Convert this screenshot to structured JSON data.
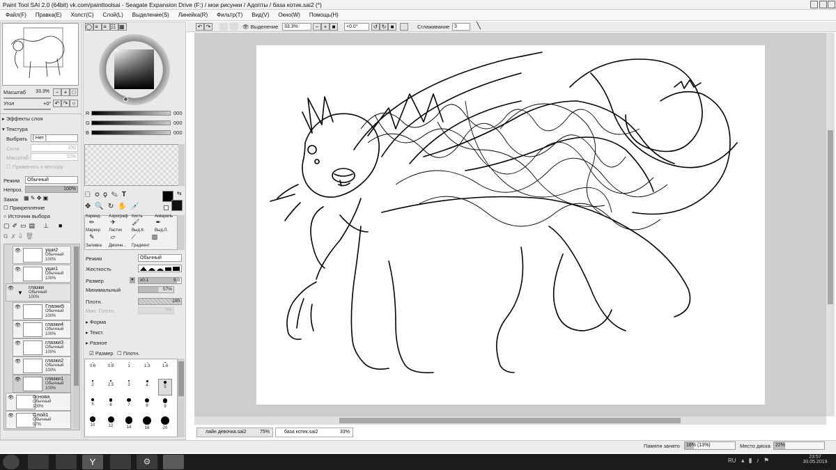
{
  "window": {
    "title": "Paint Tool SAI 2.0 (64bit) vk.com/painttoolsai - Seagate Expansion Drive (F:) / мои рисунки / Адопты / база котик.sai2 (*)"
  },
  "menu": [
    "Файл(F)",
    "Правка(E)",
    "Холст(C)",
    "Слой(L)",
    "Выделение(S)",
    "Линейка(R)",
    "Фильтр(T)",
    "Вид(V)",
    "Окно(W)",
    "Помощь(H)"
  ],
  "navigator": {
    "zoom_label": "Масштаб",
    "zoom_value": "33.3%",
    "angle_label": "Угол",
    "angle_value": "+0°"
  },
  "effects": {
    "header": "Эффекты слоя",
    "texture_header": "Текстура",
    "select_label": "Выбрать",
    "select_value": "[ Нет ]",
    "strength_label": "Сила",
    "strength_value": "100",
    "scale_label": "Масштаб",
    "scale_value": "10%",
    "apply_vector": "Применить к вектору"
  },
  "layer_props": {
    "mode_label": "Режим",
    "mode_value": "Обычный",
    "opacity_label": "Непроз.",
    "opacity_value": "100%",
    "lock_label": "Замок",
    "clip_label": "Прикрепление",
    "source_label": "Источник выбора"
  },
  "layers": [
    {
      "name": "уши2",
      "mode": "Обычный",
      "opacity": "100%"
    },
    {
      "name": "уши1",
      "mode": "Обычный",
      "opacity": "100%"
    },
    {
      "name": "глазки",
      "mode": "Обычный",
      "opacity": "100%",
      "folder": true
    },
    {
      "name": "Глазки5",
      "mode": "Обычный",
      "opacity": "100%"
    },
    {
      "name": "глазки4",
      "mode": "Обычный",
      "opacity": "100%"
    },
    {
      "name": "глазки3",
      "mode": "Обычный",
      "opacity": "100%"
    },
    {
      "name": "глазки2",
      "mode": "Обычный",
      "opacity": "100%"
    },
    {
      "name": "глазки1",
      "mode": "Обычный",
      "opacity": "100%"
    },
    {
      "name": "основа",
      "mode": "Обычный",
      "opacity": "100%"
    },
    {
      "name": "Слой1",
      "mode": "Обычный",
      "opacity": "57%"
    }
  ],
  "color": {
    "r_label": "R",
    "g_label": "G",
    "b_label": "B",
    "r_value": "000",
    "g_value": "000",
    "b_value": "000"
  },
  "tools": {
    "row1": [
      "Каранд.",
      "Аэрограф",
      "Кисть",
      "Акварель"
    ],
    "row2": [
      "Маркер",
      "Ластик",
      "Выд.К.",
      "Выд.Л."
    ],
    "row3": [
      "Заливка",
      "Двоичн...",
      "Градиент"
    ]
  },
  "brush": {
    "mode_label": "Режим",
    "mode_value": "Обычный",
    "hardness_label": "Жесткость",
    "size_label": "Размер",
    "size_mult": "x0.1",
    "size_value": "9.0",
    "min_label": "Минимальный",
    "min_value": "57%",
    "density_label": "Плотн.",
    "density_value": "100",
    "min_density_label": "Мин. Плотн.",
    "min_density_value": "0%",
    "section_shape": "Форма",
    "section_texture": "Текст.",
    "section_misc": "Разное",
    "check_size": "Размер",
    "check_density": "Плотн."
  },
  "brush_sizes": [
    "0.6",
    "0.8",
    "1",
    "1.3",
    "1.6",
    "2",
    "2.5",
    "3",
    "4",
    "5",
    "5",
    "6",
    "7",
    "8",
    "9",
    "10",
    "12",
    "14",
    "16",
    "20"
  ],
  "toolbar": {
    "selection_label": "Выделение",
    "zoom_value": "33.3%",
    "angle_value": "+0.0°",
    "stabilizer_label": "Сглаживание",
    "stabilizer_value": "3"
  },
  "tabs": [
    {
      "name": "лайн девочка.sai2",
      "zoom": "75%"
    },
    {
      "name": "база котик.sai2",
      "zoom": "33%"
    }
  ],
  "status": {
    "memory_label": "Памяти занято",
    "memory_value": "18% (13%)",
    "disk_label": "Место диска",
    "disk_value": "22%"
  },
  "taskbar": {
    "lang": "RU",
    "time": "23:57",
    "date": "30.05.2019"
  }
}
